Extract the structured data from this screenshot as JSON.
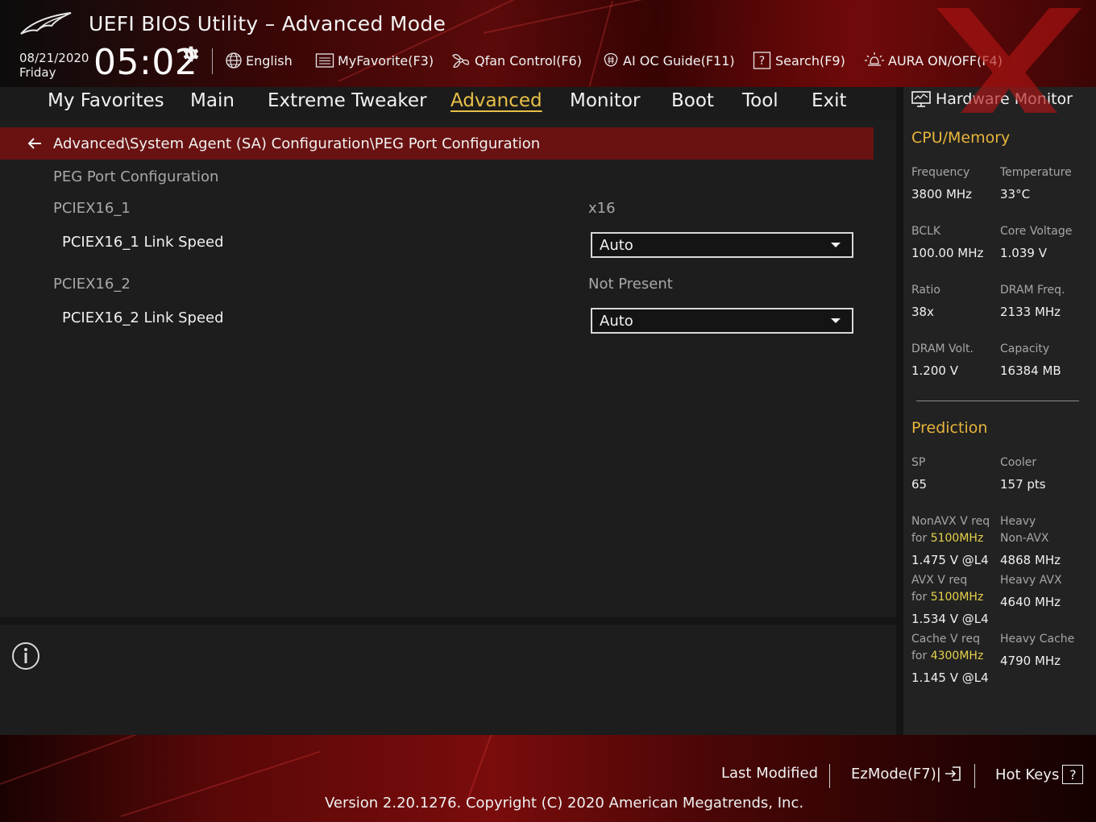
{
  "header": {
    "title": "UEFI BIOS Utility – Advanced Mode",
    "date": "08/21/2020",
    "day": "Friday",
    "time": "05:02",
    "toolbar": {
      "language": "English",
      "my_favorite": "MyFavorite(F3)",
      "qfan": "Qfan Control(F6)",
      "ai_oc": "AI OC Guide(F11)",
      "search": "Search(F9)",
      "aura": "AURA ON/OFF(F4)"
    }
  },
  "menu": {
    "tabs": [
      "My Favorites",
      "Main",
      "Extreme Tweaker",
      "Advanced",
      "Monitor",
      "Boot",
      "Tool",
      "Exit"
    ],
    "active": "Advanced"
  },
  "main": {
    "breadcrumb": "Advanced\\System Agent (SA) Configuration\\PEG Port Configuration",
    "section_title": "PEG Port Configuration",
    "items": [
      {
        "label": "PCIEX16_1",
        "value": "x16"
      },
      {
        "label": "PCIEX16_1 Link Speed",
        "dropdown": "Auto"
      },
      {
        "label": "PCIEX16_2",
        "value": "Not Present"
      },
      {
        "label": "PCIEX16_2 Link Speed",
        "dropdown": "Auto"
      }
    ]
  },
  "hardware_monitor": {
    "title": "Hardware Monitor",
    "cpu_memory": {
      "title": "CPU/Memory",
      "frequency_label": "Frequency",
      "frequency": "3800 MHz",
      "temperature_label": "Temperature",
      "temperature": "33°C",
      "bclk_label": "BCLK",
      "bclk": "100.00 MHz",
      "core_voltage_label": "Core Voltage",
      "core_voltage": "1.039 V",
      "ratio_label": "Ratio",
      "ratio": "38x",
      "dram_freq_label": "DRAM Freq.",
      "dram_freq": "2133 MHz",
      "dram_volt_label": "DRAM Volt.",
      "dram_volt": "1.200 V",
      "capacity_label": "Capacity",
      "capacity": "16384 MB"
    },
    "prediction": {
      "title": "Prediction",
      "sp_label": "SP",
      "sp": "65",
      "cooler_label": "Cooler",
      "cooler": "157 pts",
      "nonavx_label": "NonAVX V req",
      "nonavx_for": "for",
      "nonavx_freq": "5100MHz",
      "nonavx_value": "1.475 V @L4",
      "heavy_nonavx_label_1": "Heavy",
      "heavy_nonavx_label_2": "Non-AVX",
      "heavy_nonavx_value": "4868 MHz",
      "avx_label": "AVX V req",
      "avx_for": "for",
      "avx_freq": "5100MHz",
      "avx_value": "1.534 V @L4",
      "heavy_avx_label": "Heavy AVX",
      "heavy_avx_value": "4640 MHz",
      "cache_label": "Cache V req",
      "cache_for": "for",
      "cache_freq": "4300MHz",
      "cache_value": "1.145 V @L4",
      "heavy_cache_label": "Heavy Cache",
      "heavy_cache_value": "4790 MHz"
    }
  },
  "footer": {
    "last_modified": "Last Modified",
    "ezmode": "EzMode(F7)|",
    "hot_keys": "Hot Keys",
    "hot_keys_icon": "?",
    "version": "Version 2.20.1276. Copyright (C) 2020 American Megatrends, Inc."
  },
  "colors": {
    "accent_gold": "#e8b53c",
    "active_tab": "#e8c048",
    "breadcrumb_bg": "#6a1212",
    "highlight_freq": "#e6d24a"
  }
}
